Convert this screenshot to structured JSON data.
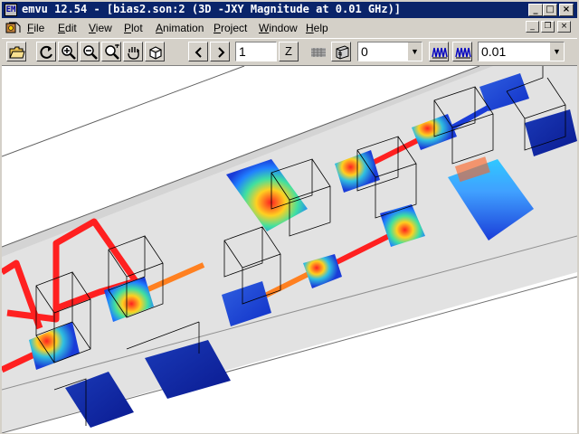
{
  "window": {
    "title": "emvu 12.54 - [bias2.son:2 (3D -JXY Magnitude at 0.01 GHz)]",
    "app_icon_glyph": "EM"
  },
  "caption_buttons": {
    "minimize": "_",
    "maximize": "□",
    "close": "×"
  },
  "mdi_buttons": {
    "minimize": "_",
    "restore": "❐",
    "close": "×"
  },
  "menu": [
    {
      "label": "File",
      "underline": "F",
      "rest": "ile"
    },
    {
      "label": "Edit",
      "underline": "E",
      "rest": "dit"
    },
    {
      "label": "View",
      "underline": "V",
      "rest": "iew"
    },
    {
      "label": "Plot",
      "underline": "P",
      "rest": "lot"
    },
    {
      "label": "Animation",
      "underline": "A",
      "rest": "nimation"
    },
    {
      "label": "Project",
      "underline": "P",
      "rest": "roject"
    },
    {
      "label": "Window",
      "underline": "W",
      "rest": "indow"
    },
    {
      "label": "Help",
      "underline": "H",
      "rest": "elp"
    }
  ],
  "toolbar": {
    "open_icon": "folder-open-icon",
    "rotate_icon": "rotate-icon",
    "zoom_in_icon": "zoom-in-icon",
    "zoom_out_icon": "zoom-out-icon",
    "zoom_window_icon": "zoom-window-icon",
    "pan_icon": "hand-pan-icon",
    "view3d_icon": "cube-view-icon",
    "prev_icon": "arrow-left-icon",
    "next_icon": "arrow-right-icon",
    "frame_value": "1",
    "z_label": "Z",
    "level_combo_value": "0",
    "frequency_combo_value": "0.01"
  },
  "colors": {
    "titlebar": "#0a246a",
    "chrome": "#d4d0c8",
    "substrate": "#e2e2e2",
    "current_high": "#ff2020",
    "current_mid": "#ff8020",
    "current_low": "#1a3cd8"
  }
}
